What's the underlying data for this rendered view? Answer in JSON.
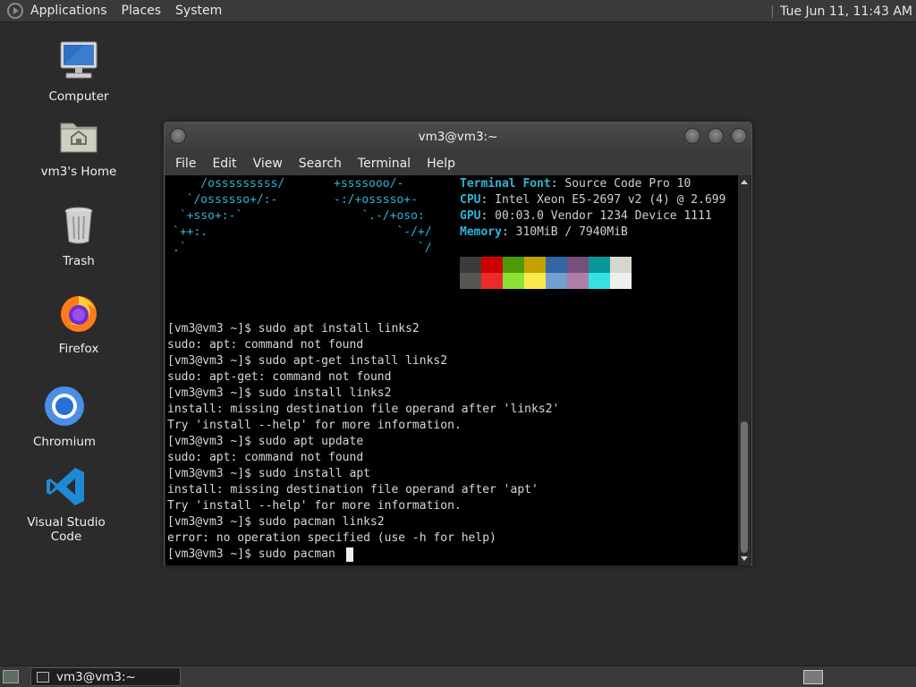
{
  "top_panel": {
    "menus": [
      "Applications",
      "Places",
      "System"
    ],
    "clock": "Tue Jun 11, 11:43 AM"
  },
  "desktop": {
    "icons": [
      {
        "label": "Computer",
        "icon": "computer-icon"
      },
      {
        "label": "vm3's Home",
        "icon": "home-folder-icon"
      },
      {
        "label": "Trash",
        "icon": "trash-icon"
      },
      {
        "label": "Firefox",
        "icon": "firefox-icon"
      },
      {
        "label": "Chromium",
        "icon": "chromium-icon"
      },
      {
        "label": "Visual Studio Code",
        "icon": "vscode-icon"
      }
    ]
  },
  "terminal": {
    "title": "vm3@vm3:~",
    "menu": [
      "File",
      "Edit",
      "View",
      "Search",
      "Terminal",
      "Help"
    ],
    "ascii_art": [
      "    /osssssssss/       +ssssooo/-",
      "  `/ossssso+/:-        -:/+osssso+-",
      " `+sso+:-`                 `.-/+oso:",
      "`++:.                           `-/+/",
      ".`                                 `/"
    ],
    "sysinfo": [
      {
        "key": "Terminal Font",
        "value": " Source Code Pro 10"
      },
      {
        "key": "CPU",
        "value": " Intel Xeon E5-2697 v2 (4) @ 2.699"
      },
      {
        "key": "GPU",
        "value": " 00:03.0 Vendor 1234 Device 1111"
      },
      {
        "key": "Memory",
        "value": " 310MiB / 7940MiB"
      }
    ],
    "palette_top": [
      "#3b3b3b",
      "#cc0000",
      "#4e9a06",
      "#c4a000",
      "#3465a4",
      "#75507b",
      "#06989a",
      "#d3d7cf"
    ],
    "palette_bottom": [
      "#555753",
      "#ef2929",
      "#8ae234",
      "#fce94f",
      "#729fcf",
      "#ad7fa8",
      "#34e2e2",
      "#eeeeec"
    ],
    "output_lines": [
      "[vm3@vm3 ~]$ sudo apt install links2",
      "sudo: apt: command not found",
      "[vm3@vm3 ~]$ sudo apt-get install links2",
      "sudo: apt-get: command not found",
      "[vm3@vm3 ~]$ sudo install links2",
      "install: missing destination file operand after 'links2'",
      "Try 'install --help' for more information.",
      "[vm3@vm3 ~]$ sudo apt update",
      "sudo: apt: command not found",
      "[vm3@vm3 ~]$ sudo install apt",
      "install: missing destination file operand after 'apt'",
      "Try 'install --help' for more information.",
      "[vm3@vm3 ~]$ sudo pacman links2",
      "error: no operation specified (use -h for help)",
      "[vm3@vm3 ~]$ sudo pacman "
    ]
  },
  "bottom_panel": {
    "task_label": "vm3@vm3:~"
  }
}
